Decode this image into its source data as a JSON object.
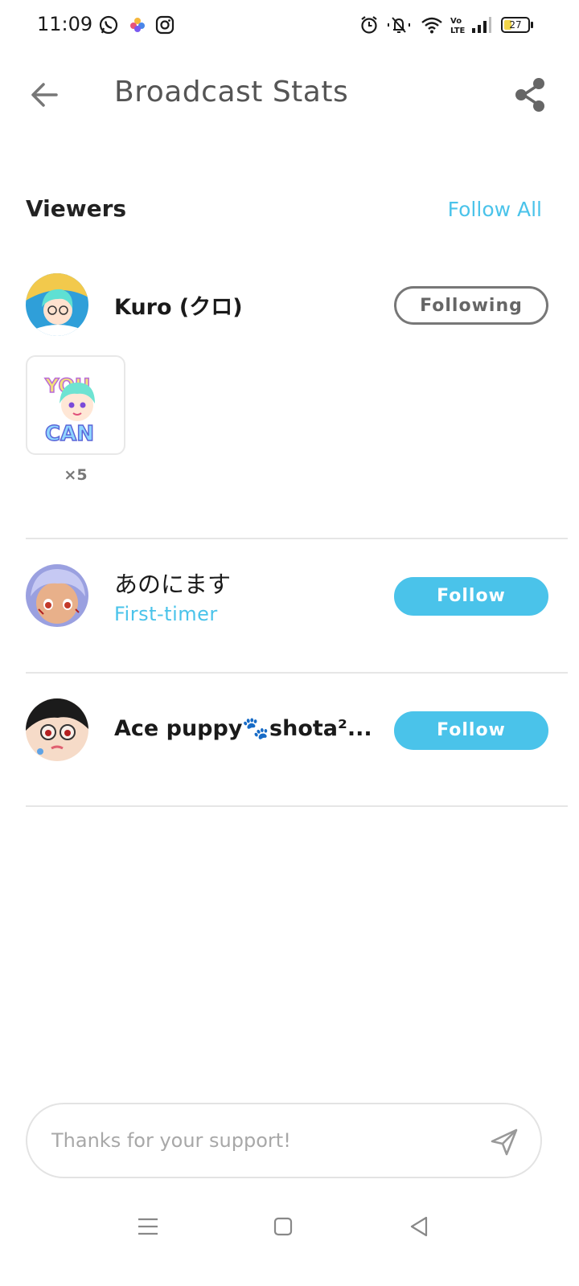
{
  "status_bar": {
    "time": "11:09",
    "apps": [
      "whatsapp-icon",
      "photos-icon",
      "instagram-icon"
    ],
    "indicators": [
      "alarm-icon",
      "mute-icon",
      "wifi-icon",
      "volte-icon",
      "signal-icon"
    ],
    "battery": "27"
  },
  "header": {
    "title": "Broadcast Stats",
    "back_icon": "back-arrow-icon",
    "share_icon": "share-icon"
  },
  "viewers": {
    "title": "Viewers",
    "follow_all": "Follow All",
    "items": [
      {
        "name": "Kuro (クロ)",
        "button": "Following",
        "gift": {
          "badge_top": "YOU",
          "badge_bottom": "CAN",
          "count": "×5"
        }
      },
      {
        "name": "あのにます",
        "subtitle": "First-timer",
        "button": "Follow"
      },
      {
        "name": "Ace puppy🐾shota²...",
        "button": "Follow"
      }
    ]
  },
  "comment": {
    "placeholder": "Thanks for your support!",
    "send_icon": "send-icon"
  },
  "colors": {
    "accent": "#4ac3ea",
    "title_gray": "#555555",
    "divider": "#e6e6e6"
  },
  "nav_bar": [
    "menu-icon",
    "home-icon",
    "back-icon"
  ]
}
